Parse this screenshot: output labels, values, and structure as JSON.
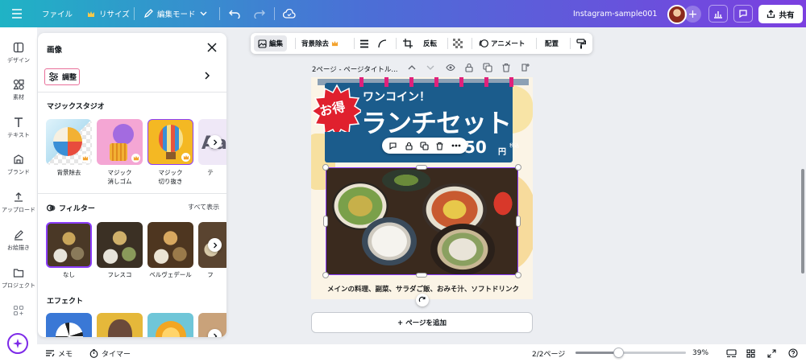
{
  "topbar": {
    "file_label": "ファイル",
    "resize_label": "リサイズ",
    "edit_mode_label": "編集モード",
    "doc_title": "Instagram-sample001",
    "share_label": "共有"
  },
  "rail": {
    "items": [
      {
        "label": "デザイン",
        "icon": "layout-icon"
      },
      {
        "label": "素材",
        "icon": "shapes-icon"
      },
      {
        "label": "テキスト",
        "icon": "text-icon"
      },
      {
        "label": "ブランド",
        "icon": "brand-icon"
      },
      {
        "label": "アップロード",
        "icon": "upload-icon"
      },
      {
        "label": "お絵描き",
        "icon": "draw-icon"
      },
      {
        "label": "プロジェクト",
        "icon": "folder-icon"
      },
      {
        "label": "",
        "icon": "apps-icon"
      }
    ]
  },
  "panel": {
    "title": "画像",
    "adjust_label": "調整",
    "magic_studio_heading": "マジックスタジオ",
    "magic_tools": [
      {
        "label": "背景除去"
      },
      {
        "label": "マジック\n消しゴム"
      },
      {
        "label": "マジック\n切り抜き"
      },
      {
        "label": "テ"
      }
    ],
    "filter_heading": "フィルター",
    "see_all_label": "すべて表示",
    "filters": [
      {
        "label": "なし"
      },
      {
        "label": "フレスコ"
      },
      {
        "label": "ベルヴェデール"
      },
      {
        "label": "フ"
      }
    ],
    "effects_heading": "エフェクト"
  },
  "context_toolbar": {
    "edit_label": "編集",
    "bg_remove_label": "背景除去",
    "crop_label": "反転",
    "animate_label": "アニメート",
    "position_label": "配置"
  },
  "page": {
    "header": "2ページ - ページタイトル...",
    "badge_text": "お得",
    "banner_subtitle": "ワンコイン！",
    "banner_title": "ランチセット",
    "price_value": "50",
    "price_unit": "円",
    "price_tax": "税込",
    "caption": "メインの料理、副菜、サラダご飯、おみそ汁、ソフトドリンク"
  },
  "add_page_label": "+ ページを追加",
  "bottombar": {
    "memo_label": "メモ",
    "timer_label": "タイマー",
    "page_count": "2/2ページ",
    "zoom_label": "39%",
    "zoom_value": 0.39
  },
  "colors": {
    "accent": "#8b3dff",
    "banner_blue": "#1b5c8c",
    "badge_red": "#e0202e",
    "adjust_outline": "#e8709a"
  }
}
